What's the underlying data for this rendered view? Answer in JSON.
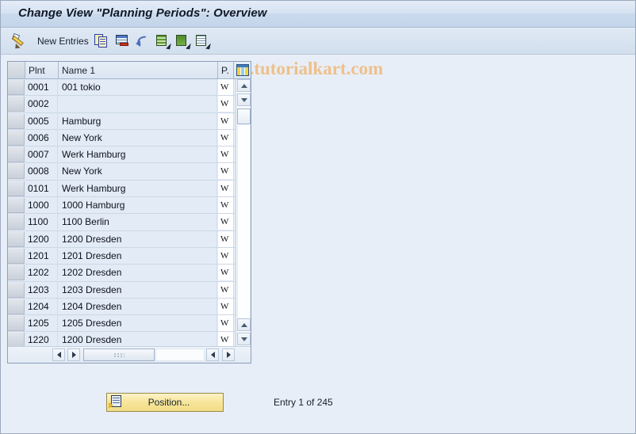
{
  "window": {
    "title": "Change View \"Planning Periods\": Overview"
  },
  "toolbar": {
    "edit_icon": "pencil-icon",
    "new_entries_label": "New Entries",
    "buttons": [
      {
        "name": "copy-icon",
        "title": "Copy As..."
      },
      {
        "name": "delete-icon",
        "title": "Delete"
      },
      {
        "name": "undo-icon",
        "title": "Undo Change"
      },
      {
        "name": "select-all-icon",
        "title": "Select All"
      },
      {
        "name": "select-block-icon",
        "title": "Select Block"
      },
      {
        "name": "deselect-all-icon",
        "title": "Deselect All"
      }
    ],
    "watermark": "www.tutorialkart.com",
    "watermark_color": "#eec08a"
  },
  "table": {
    "columns": [
      {
        "key": "selector",
        "label": ""
      },
      {
        "key": "plnt",
        "label": "Plnt"
      },
      {
        "key": "name1",
        "label": "Name 1"
      },
      {
        "key": "p",
        "label": "P."
      }
    ],
    "config_icon": "table-settings-icon",
    "rows": [
      {
        "plnt": "0001",
        "name1": "001 tokio",
        "p": "W"
      },
      {
        "plnt": "0002",
        "name1": "",
        "p": "W"
      },
      {
        "plnt": "0005",
        "name1": "Hamburg",
        "p": "W"
      },
      {
        "plnt": "0006",
        "name1": "New York",
        "p": "W"
      },
      {
        "plnt": "0007",
        "name1": "Werk Hamburg",
        "p": "W"
      },
      {
        "plnt": "0008",
        "name1": "New York",
        "p": "W"
      },
      {
        "plnt": "0101",
        "name1": "Werk Hamburg",
        "p": "W"
      },
      {
        "plnt": "1000",
        "name1": "1000 Hamburg",
        "p": "W"
      },
      {
        "plnt": "1100",
        "name1": "1100 Berlin",
        "p": "W"
      },
      {
        "plnt": "1200",
        "name1": "1200 Dresden",
        "p": "W"
      },
      {
        "plnt": "1201",
        "name1": "1201 Dresden",
        "p": "W"
      },
      {
        "plnt": "1202",
        "name1": "1202 Dresden",
        "p": "W"
      },
      {
        "plnt": "1203",
        "name1": "1203 Dresden",
        "p": "W"
      },
      {
        "plnt": "1204",
        "name1": "1204 Dresden",
        "p": "W"
      },
      {
        "plnt": "1205",
        "name1": "1205 Dresden",
        "p": "W"
      },
      {
        "plnt": "1220",
        "name1": "1200 Dresden",
        "p": "W"
      }
    ]
  },
  "footer": {
    "position_button_label": "Position...",
    "entry_status": "Entry 1 of 245"
  },
  "colors": {
    "title_text": "#101826",
    "panel_bg": "#e8eef7",
    "row_bg": "#e3ebf6",
    "button_yellow": "#f7e59a"
  }
}
